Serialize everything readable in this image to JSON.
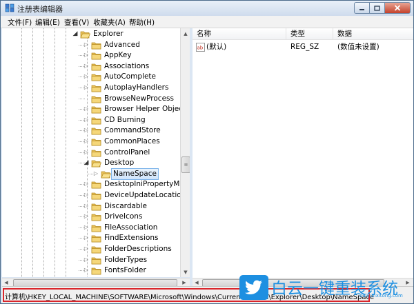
{
  "window": {
    "title": "注册表编辑器"
  },
  "menu": [
    "文件(F)",
    "编辑(E)",
    "查看(V)",
    "收藏夹(A)",
    "帮助(H)"
  ],
  "tree": {
    "parent": "Explorer",
    "children": [
      {
        "label": "Advanced",
        "expanded": false
      },
      {
        "label": "AppKey",
        "expanded": false
      },
      {
        "label": "Associations",
        "expanded": false
      },
      {
        "label": "AutoComplete",
        "expanded": false
      },
      {
        "label": "AutoplayHandlers",
        "expanded": false
      },
      {
        "label": "BrowseNewProcess",
        "expanded": null
      },
      {
        "label": "Browser Helper Objects",
        "expanded": false
      },
      {
        "label": "CD Burning",
        "expanded": false
      },
      {
        "label": "CommandStore",
        "expanded": false
      },
      {
        "label": "CommonPlaces",
        "expanded": false
      },
      {
        "label": "ControlPanel",
        "expanded": false
      },
      {
        "label": "Desktop",
        "expanded": true
      },
      {
        "label": "NameSpace",
        "child": true,
        "selected": true
      },
      {
        "label": "DesktopIniPropertyMap",
        "expanded": false
      },
      {
        "label": "DeviceUpdateLocations",
        "expanded": false
      },
      {
        "label": "Discardable",
        "expanded": false
      },
      {
        "label": "DriveIcons",
        "expanded": false
      },
      {
        "label": "FileAssociation",
        "expanded": false
      },
      {
        "label": "FindExtensions",
        "expanded": false
      },
      {
        "label": "FolderDescriptions",
        "expanded": false
      },
      {
        "label": "FolderTypes",
        "expanded": false
      },
      {
        "label": "FontsFolder",
        "expanded": false
      }
    ]
  },
  "values": {
    "headers": {
      "name": "名称",
      "type": "类型",
      "data": "数据"
    },
    "rows": [
      {
        "name": "(默认)",
        "type": "REG_SZ",
        "data": "(数值未设置)",
        "icon": "string-value-icon"
      }
    ]
  },
  "status": {
    "path": "计算机\\HKEY_LOCAL_MACHINE\\SOFTWARE\\Microsoft\\Windows\\CurrentVersion\\Explorer\\Desktop\\NameSpace"
  },
  "watermark": {
    "text": "白云一键重装系统",
    "small": "baiyunxitong.com"
  },
  "colors": {
    "selection": "#cfe4fb",
    "highlight_border": "#d9262c",
    "watermark": "#1d8fe1"
  }
}
